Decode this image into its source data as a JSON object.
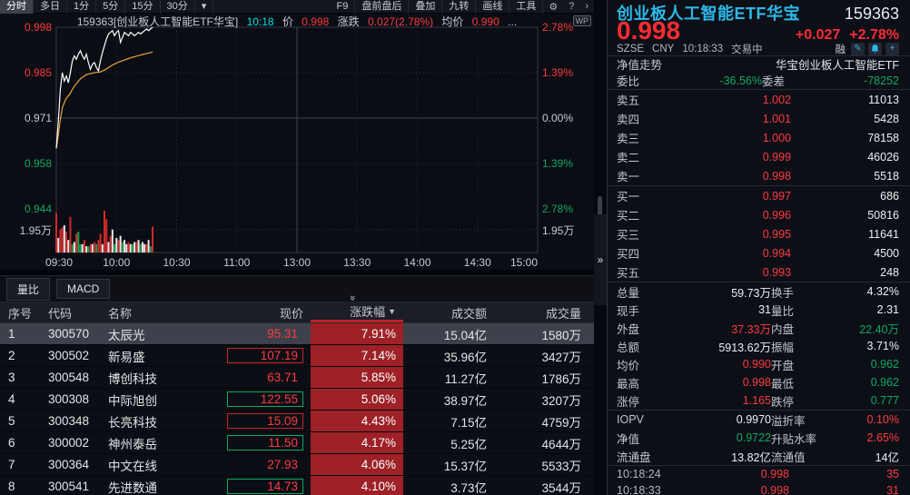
{
  "colors": {
    "red": "#fa3b3f",
    "green": "#0fa862",
    "cyan_title": "#2eb8e8",
    "cyan_time": "#00dde4",
    "avg_line": "#e8a33d",
    "price_line": "#ffffff",
    "pct_cell_bg": "#9d2127",
    "selected_row_bg": "#3d414b"
  },
  "toolbar": {
    "periods": [
      "分时",
      "多日",
      "1分",
      "5分",
      "15分",
      "30分"
    ],
    "active_period": "分时",
    "more_dropdown": "▾",
    "right_items": [
      "F9",
      "盘前盘后",
      "叠加",
      "九转",
      "画线",
      "工具"
    ],
    "gear": "⚙",
    "help": "?",
    "expand": "›"
  },
  "chart_header": {
    "code_name": "159363[创业板人工智能ETF华宝]",
    "time": "10:18",
    "price_label": "价",
    "price": "0.998",
    "change_label": "涨跌",
    "change": "0.027(2.78%)",
    "avg_label": "均价",
    "avg": "0.990",
    "ellipsis": "...",
    "wp_badge": "WP"
  },
  "chart_data": {
    "type": "line",
    "title": "159363 创业板人工智能ETF华宝 分时走势",
    "x_axis_labels": [
      "09:30",
      "10:00",
      "10:30",
      "11:00",
      "13:00",
      "13:30",
      "14:00",
      "14:30",
      "15:00"
    ],
    "left_price_ticks": [
      {
        "v": "0.998",
        "c": "red"
      },
      {
        "v": "0.985",
        "c": "red"
      },
      {
        "v": "0.971",
        "c": "gray"
      },
      {
        "v": "0.958",
        "c": "green"
      },
      {
        "v": "0.944",
        "c": "green"
      }
    ],
    "right_pct_ticks": [
      {
        "v": "2.78%",
        "c": "red"
      },
      {
        "v": "1.39%",
        "c": "red"
      },
      {
        "v": "0.00%",
        "c": "gray"
      },
      {
        "v": "1.39%",
        "c": "green"
      },
      {
        "v": "2.78%",
        "c": "green"
      }
    ],
    "volume_tick": "1.95万",
    "prev_close": 0.971,
    "price_range": [
      0.944,
      0.998
    ],
    "session_minutes": 240,
    "legend_position": "none",
    "grid": true,
    "price_series": [
      0.962,
      0.97,
      0.9795,
      0.9845,
      0.982,
      0.9835,
      0.9815,
      0.9845,
      0.988,
      0.9895,
      0.9885,
      0.99,
      0.991,
      0.9895,
      0.9885,
      0.99,
      0.9875,
      0.9855,
      0.987,
      0.9875,
      0.986,
      0.985,
      0.988,
      0.9905,
      0.9925,
      0.9945,
      0.996,
      0.9965,
      0.997,
      0.9955,
      0.9965,
      0.997,
      0.9935,
      0.995,
      0.9965,
      0.996,
      0.9955,
      0.9965,
      0.996,
      0.9955,
      0.996,
      0.9965,
      0.996,
      0.9965,
      0.997,
      0.9975,
      0.997,
      0.9975,
      0.998
    ],
    "volume_bars": [
      [
        0.95,
        "r"
      ],
      [
        0.35,
        "w"
      ],
      [
        0.55,
        "r"
      ],
      [
        0.6,
        "r"
      ],
      [
        0.65,
        "w"
      ],
      [
        0.5,
        "r"
      ],
      [
        0.3,
        "w"
      ],
      [
        0.85,
        "r"
      ],
      [
        0.2,
        "g"
      ],
      [
        0.25,
        "w"
      ],
      [
        0.45,
        "r"
      ],
      [
        0.5,
        "g"
      ],
      [
        0.2,
        "g"
      ],
      [
        0.2,
        "w"
      ],
      [
        0.3,
        "r"
      ],
      [
        0.15,
        "w"
      ],
      [
        0.15,
        "g"
      ],
      [
        0.2,
        "r"
      ],
      [
        0.2,
        "w"
      ],
      [
        0.25,
        "r"
      ],
      [
        0.2,
        "g"
      ],
      [
        0.3,
        "r"
      ],
      [
        0.45,
        "r"
      ],
      [
        0.2,
        "w"
      ],
      [
        1.0,
        "r"
      ],
      [
        0.8,
        "r"
      ],
      [
        0.25,
        "w"
      ],
      [
        0.4,
        "r"
      ],
      [
        0.55,
        "w"
      ],
      [
        0.2,
        "g"
      ],
      [
        0.35,
        "w"
      ],
      [
        0.3,
        "r"
      ],
      [
        0.4,
        "w"
      ],
      [
        0.25,
        "g"
      ],
      [
        0.3,
        "w"
      ],
      [
        0.2,
        "w"
      ],
      [
        0.25,
        "r"
      ],
      [
        0.2,
        "w"
      ],
      [
        0.2,
        "g"
      ],
      [
        0.25,
        "w"
      ],
      [
        0.25,
        "r"
      ],
      [
        0.3,
        "w"
      ],
      [
        0.2,
        "g"
      ],
      [
        0.25,
        "w"
      ],
      [
        0.2,
        "w"
      ],
      [
        0.2,
        "r"
      ],
      [
        0.3,
        "w"
      ],
      [
        0.15,
        "g"
      ],
      [
        0.62,
        "r"
      ]
    ]
  },
  "bottom_tabs": {
    "tabs": [
      "量比",
      "MACD"
    ],
    "collapse_icon": "»"
  },
  "table": {
    "columns": [
      "序号",
      "代码",
      "名称",
      "现价",
      "涨跌幅",
      "成交额",
      "成交量"
    ],
    "sort_column": "涨跌幅",
    "sort_arrow": "▼",
    "rows": [
      {
        "idx": "1",
        "code": "300570",
        "name": "太辰光",
        "price": "95.31",
        "pct": "7.91%",
        "turnover": "15.04亿",
        "volume": "1580万",
        "price_box": "none",
        "selected": true
      },
      {
        "idx": "2",
        "code": "300502",
        "name": "新易盛",
        "price": "107.19",
        "pct": "7.14%",
        "turnover": "35.96亿",
        "volume": "3427万",
        "price_box": "red",
        "selected": false
      },
      {
        "idx": "3",
        "code": "300548",
        "name": "博创科技",
        "price": "63.71",
        "pct": "5.85%",
        "turnover": "11.27亿",
        "volume": "1786万",
        "price_box": "none",
        "selected": false
      },
      {
        "idx": "4",
        "code": "300308",
        "name": "中际旭创",
        "price": "122.55",
        "pct": "5.06%",
        "turnover": "38.97亿",
        "volume": "3207万",
        "price_box": "green",
        "selected": false
      },
      {
        "idx": "5",
        "code": "300348",
        "name": "长亮科技",
        "price": "15.09",
        "pct": "4.43%",
        "turnover": "7.15亿",
        "volume": "4759万",
        "price_box": "red",
        "selected": false
      },
      {
        "idx": "6",
        "code": "300002",
        "name": "神州泰岳",
        "price": "11.50",
        "pct": "4.17%",
        "turnover": "5.25亿",
        "volume": "4644万",
        "price_box": "green",
        "selected": false
      },
      {
        "idx": "7",
        "code": "300364",
        "name": "中文在线",
        "price": "27.93",
        "pct": "4.06%",
        "turnover": "15.37亿",
        "volume": "5533万",
        "price_box": "none",
        "selected": false
      },
      {
        "idx": "8",
        "code": "300541",
        "name": "先进数通",
        "price": "14.73",
        "pct": "4.10%",
        "turnover": "3.73亿",
        "volume": "3544万",
        "price_box": "green",
        "selected": false
      }
    ]
  },
  "right_panel": {
    "title": "创业板人工智能ETF华宝",
    "code": "159363",
    "price": "0.998",
    "change": "+0.027",
    "change_pct": "+2.78%",
    "exchange": "SZSE",
    "currency": "CNY",
    "time": "10:18:33",
    "status": "交易中",
    "margin_badge": "融",
    "fund_row": {
      "label": "净值走势",
      "value": "华宝创业板人工智能ETF"
    },
    "weibi": {
      "label1": "委比",
      "value1": "-36.56%",
      "label2": "委差",
      "value2": "-78252"
    },
    "asks": [
      {
        "label": "卖五",
        "price": "1.002",
        "vol": "11013"
      },
      {
        "label": "卖四",
        "price": "1.001",
        "vol": "5428"
      },
      {
        "label": "卖三",
        "price": "1.000",
        "vol": "78158"
      },
      {
        "label": "卖二",
        "price": "0.999",
        "vol": "46026"
      },
      {
        "label": "卖一",
        "price": "0.998",
        "vol": "5518"
      }
    ],
    "bids": [
      {
        "label": "买一",
        "price": "0.997",
        "vol": "686"
      },
      {
        "label": "买二",
        "price": "0.996",
        "vol": "50816"
      },
      {
        "label": "买三",
        "price": "0.995",
        "vol": "11641"
      },
      {
        "label": "买四",
        "price": "0.994",
        "vol": "4500"
      },
      {
        "label": "买五",
        "price": "0.993",
        "vol": "248"
      }
    ],
    "stats": [
      [
        "总量",
        "59.73万",
        "w",
        "换手",
        "4.32%",
        "w"
      ],
      [
        "现手",
        "31",
        "w",
        "量比",
        "2.31",
        "w"
      ],
      [
        "外盘",
        "37.33万",
        "r",
        "内盘",
        "22.40万",
        "g"
      ],
      [
        "总额",
        "5913.62万",
        "w",
        "振幅",
        "3.71%",
        "w"
      ],
      [
        "均价",
        "0.990",
        "r",
        "开盘",
        "0.962",
        "g"
      ],
      [
        "最高",
        "0.998",
        "r",
        "最低",
        "0.962",
        "g"
      ],
      [
        "涨停",
        "1.165",
        "r",
        "跌停",
        "0.777",
        "g"
      ]
    ],
    "iopv": [
      [
        "IOPV",
        "0.9970",
        "w",
        "溢折率",
        "0.10%",
        "r"
      ],
      [
        "净值",
        "0.9722",
        "g",
        "升贴水率",
        "2.65%",
        "r"
      ],
      [
        "流通盘",
        "13.82亿",
        "w",
        "流通值",
        "14亿",
        "w"
      ]
    ],
    "ticks": [
      {
        "time": "10:18:24",
        "price": "0.998",
        "vol": "35"
      },
      {
        "time": "10:18:33",
        "price": "0.998",
        "vol": "31"
      }
    ]
  }
}
